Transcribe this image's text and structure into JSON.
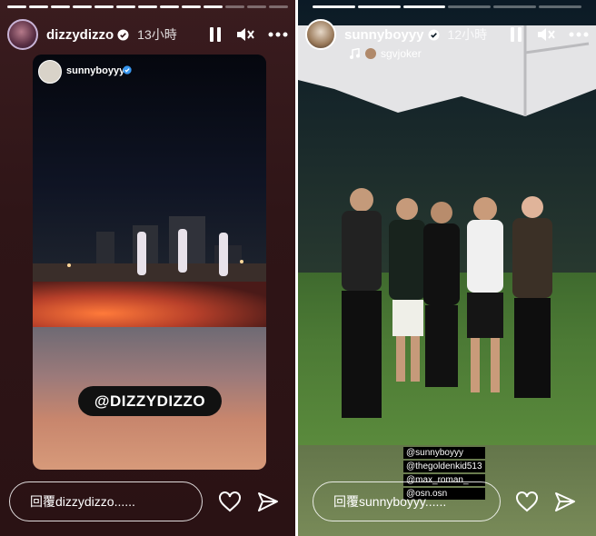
{
  "left_story": {
    "username": "dizzydizzo",
    "time": "13小時",
    "inner_post": {
      "username": "sunnyboyyy",
      "mention": "@DIZZYDIZZO"
    },
    "reply_placeholder": "回覆dizzydizzo......"
  },
  "right_story": {
    "username": "sunnyboyyy",
    "time": "12小時",
    "audio_user": "sgvjoker",
    "tags": [
      "@sunnyboyyy",
      "@thegoldenkid513",
      "@max_roman_",
      "@osn.osn"
    ],
    "reply_placeholder": "回覆sunnyboyyy......"
  },
  "icons": [
    "verified-icon",
    "pause-icon",
    "mute-icon",
    "more-icon",
    "heart-icon",
    "send-icon",
    "music-icon"
  ],
  "colors": {
    "left_bg": "#2f1517",
    "verified": "#3897f0"
  }
}
